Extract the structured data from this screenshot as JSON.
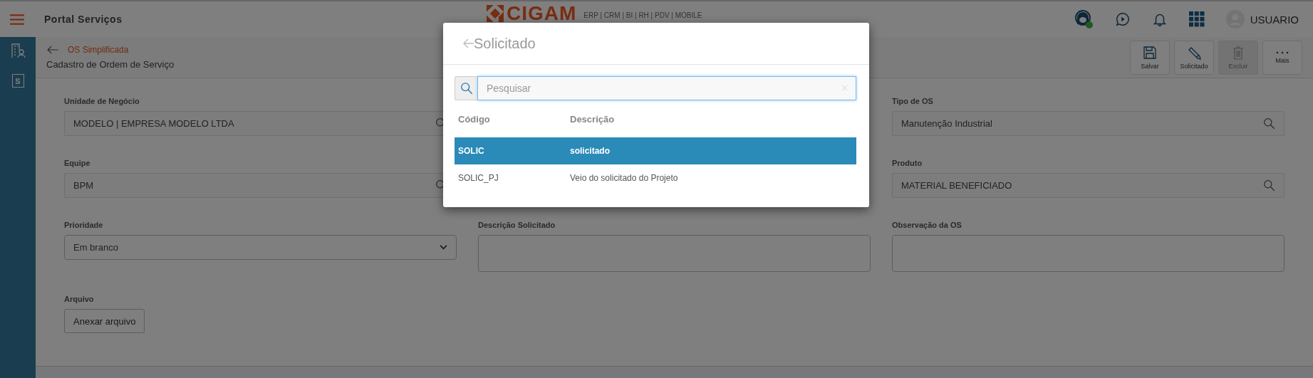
{
  "header": {
    "app_title": "Portal Serviços",
    "logo": {
      "name": "CIGAM",
      "tagline": "ERP | CRM | BI | RH | PDV | MOBILE"
    },
    "support_online": true,
    "user": "USUARIO"
  },
  "sidebar": [
    {
      "kind": "building"
    },
    {
      "kind": "letter",
      "label": "S"
    }
  ],
  "page": {
    "breadcrumb": "OS Simplificada",
    "title": "Cadastro de Ordem de Serviço"
  },
  "toolbar": [
    {
      "kind": "save",
      "label": "Salvar",
      "disabled": false
    },
    {
      "kind": "edit",
      "label": "Solicitado",
      "disabled": false
    },
    {
      "kind": "delete",
      "label": "Excluir",
      "disabled": true
    },
    {
      "kind": "more",
      "label": "Mais",
      "disabled": false
    }
  ],
  "form": {
    "rows": [
      {
        "left": {
          "kind": "lookup",
          "label": "Unidade de Negócio",
          "value": "MODELO | EMPRESA MODELO LTDA"
        },
        "right": {
          "kind": "lookup",
          "label": "Tipo de OS",
          "value": "Manutenção Industrial"
        }
      },
      {
        "left": {
          "kind": "lookup",
          "label": "Equipe",
          "value": "BPM"
        },
        "right": {
          "kind": "lookup",
          "label": "Produto",
          "value": "MATERIAL BENEFICIADO"
        }
      },
      {
        "left": {
          "kind": "select",
          "label": "Prioridade",
          "value": "Em branco"
        },
        "middle": {
          "kind": "textarea",
          "label": "Descrição Solicitado"
        },
        "right": {
          "kind": "textarea",
          "label": "Observação da OS"
        }
      },
      {
        "left": {
          "kind": "file",
          "label": "Arquivo",
          "button": "Anexar arquivo"
        }
      }
    ]
  },
  "dialog": {
    "title": "Solicitado",
    "search": {
      "placeholder": "Pesquisar"
    },
    "columns": [
      "Código",
      "Descrição"
    ],
    "rows": [
      {
        "code": "SOLIC",
        "description": "solicitado",
        "selected": true
      },
      {
        "code": "SOLIC_PJ",
        "description": "Veio do solicitado do Projeto",
        "selected": false
      }
    ]
  }
}
